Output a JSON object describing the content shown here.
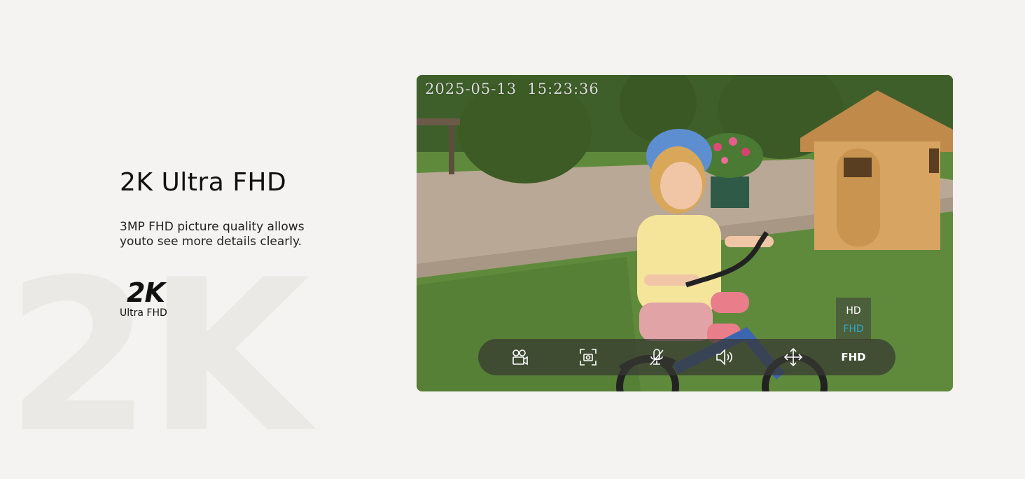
{
  "heading": "2K Ultra FHD",
  "description_line1": "3MP FHD picture quality allows",
  "description_line2": "youto see more details clearly.",
  "badge": {
    "main": "2K",
    "sub": "Ultra FHD"
  },
  "watermark": "2K",
  "viewer": {
    "timestamp": "2025-05-13  15:23:36",
    "quality_options": [
      "HD",
      "FHD"
    ],
    "quality_selected": "FHD",
    "selected_color": "#2fa9c9",
    "controls": [
      {
        "icon": "video-record-icon"
      },
      {
        "icon": "screenshot-icon"
      },
      {
        "icon": "microphone-muted-icon"
      },
      {
        "icon": "speaker-icon"
      },
      {
        "icon": "move-arrows-icon"
      }
    ],
    "quality_button_label": "FHD"
  }
}
